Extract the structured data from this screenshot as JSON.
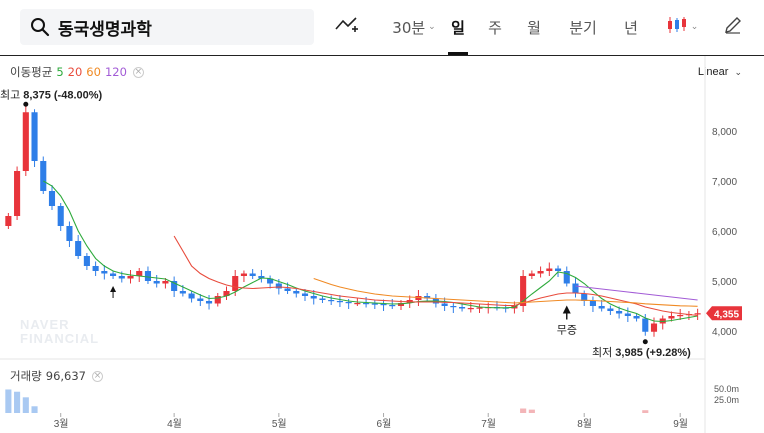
{
  "search": {
    "stock_name": "동국생명과학"
  },
  "toolbar": {
    "interval_label": "30분",
    "periods": [
      "일",
      "주",
      "월",
      "분기",
      "년"
    ],
    "active_period": "일"
  },
  "legend": {
    "ma_title": "이동평균",
    "ma_periods": [
      "5",
      "20",
      "60",
      "120"
    ],
    "scale": "Linear"
  },
  "annotations": {
    "high_label": "최고",
    "high_value": "8,375 (-48.00%)",
    "low_label": "최저",
    "low_value": "3,985 (+9.28%)",
    "event_label": "무증"
  },
  "watermark": [
    "NAVER",
    "FINANCIAL"
  ],
  "volume_legend": {
    "title": "거래량",
    "value": "96,637"
  },
  "colors": {
    "up": "#e8343b",
    "down": "#2e7ee8",
    "ma5": "#2eaa3c",
    "ma20": "#e84b3c",
    "ma60": "#f08a24",
    "ma120": "#a25bd6",
    "current_price_badge": "#e8343b"
  },
  "chart_data": {
    "type": "line",
    "subtype": "candlestick",
    "x_label_months": [
      "3월",
      "4월",
      "5월",
      "6월",
      "7월",
      "8월",
      "9월"
    ],
    "y_ticks": [
      "8,000",
      "7,000",
      "6,000",
      "5,000",
      "4,000"
    ],
    "y_tick_values": [
      8000,
      7000,
      6000,
      5000,
      4000
    ],
    "ylim": [
      3500,
      8700
    ],
    "current_price_label": "4,355",
    "current_price": 4355,
    "volume_ticks": [
      "50.0m",
      "25.0m"
    ],
    "series": [
      {
        "name": "price",
        "values": [
          6300,
          7200,
          8375,
          7400,
          6800,
          6500,
          6100,
          5800,
          5500,
          5300,
          5200,
          5150,
          5100,
          5050,
          5100,
          5200,
          5000,
          4950,
          5000,
          4800,
          4750,
          4650,
          4600,
          4550,
          4700,
          4800,
          5100,
          5150,
          5100,
          5050,
          4950,
          4850,
          4800,
          4750,
          4700,
          4650,
          4620,
          4600,
          4580,
          4560,
          4560,
          4550,
          4540,
          4520,
          4500,
          4560,
          4620,
          4700,
          4650,
          4550,
          4500,
          4480,
          4450,
          4460,
          4470,
          4480,
          4470,
          4450,
          4500,
          5100,
          5150,
          5200,
          5250,
          5200,
          4950,
          4750,
          4600,
          4500,
          4450,
          4400,
          4350,
          4300,
          4250,
          3985,
          4150,
          4250,
          4300,
          4320,
          4340,
          4355
        ]
      },
      {
        "name": "MA5",
        "values": [
          null,
          null,
          null,
          null,
          7000,
          6900,
          6700,
          6400,
          6000,
          5700,
          5450,
          5300,
          5200,
          5150,
          5120,
          5100,
          5080,
          5060,
          5040,
          4960,
          4880,
          4800,
          4720,
          4650,
          4660,
          4700,
          4780,
          4880,
          4970,
          5060,
          5050,
          4990,
          4930,
          4860,
          4800,
          4750,
          4700,
          4660,
          4630,
          4600,
          4580,
          4570,
          4560,
          4550,
          4540,
          4545,
          4560,
          4590,
          4600,
          4600,
          4590,
          4570,
          4540,
          4510,
          4480,
          4470,
          4465,
          4465,
          4475,
          4600,
          4740,
          4870,
          5000,
          5180,
          5150,
          5070,
          4950,
          4800,
          4650,
          4540,
          4460,
          4400,
          4350,
          4260,
          4200,
          4190,
          4210,
          4240,
          4270,
          4300
        ]
      },
      {
        "name": "MA20",
        "values": [
          null,
          null,
          null,
          null,
          null,
          null,
          null,
          null,
          null,
          null,
          null,
          null,
          null,
          null,
          null,
          null,
          null,
          null,
          null,
          5900,
          5600,
          5300,
          5150,
          5050,
          4980,
          4920,
          4880,
          4860,
          4850,
          4860,
          4870,
          4880,
          4870,
          4850,
          4820,
          4790,
          4760,
          4730,
          4700,
          4680,
          4660,
          4640,
          4620,
          4610,
          4600,
          4590,
          4585,
          4580,
          4580,
          4580,
          4575,
          4570,
          4560,
          4550,
          4540,
          4530,
          4520,
          4510,
          4510,
          4560,
          4610,
          4660,
          4700,
          4740,
          4760,
          4760,
          4750,
          4730,
          4700,
          4660,
          4620,
          4580,
          4540,
          4480,
          4440,
          4400,
          4370,
          4350,
          4330,
          4310
        ]
      },
      {
        "name": "MA60",
        "values": [
          null,
          null,
          null,
          null,
          null,
          null,
          null,
          null,
          null,
          null,
          null,
          null,
          null,
          null,
          null,
          null,
          null,
          null,
          null,
          null,
          null,
          null,
          null,
          null,
          null,
          null,
          null,
          null,
          null,
          null,
          null,
          null,
          null,
          null,
          null,
          5050,
          4990,
          4930,
          4880,
          4840,
          4800,
          4770,
          4740,
          4720,
          4700,
          4690,
          4680,
          4670,
          4660,
          4650,
          4640,
          4630,
          4620,
          4610,
          4600,
          4590,
          4580,
          4570,
          4560,
          4570,
          4580,
          4590,
          4600,
          4610,
          4620,
          4620,
          4615,
          4610,
          4600,
          4590,
          4580,
          4570,
          4560,
          4545,
          4535,
          4525,
          4515,
          4505,
          4500,
          4495
        ]
      },
      {
        "name": "MA120",
        "values": [
          null,
          null,
          null,
          null,
          null,
          null,
          null,
          null,
          null,
          null,
          null,
          null,
          null,
          null,
          null,
          null,
          null,
          null,
          null,
          null,
          null,
          null,
          null,
          null,
          null,
          null,
          null,
          null,
          null,
          null,
          null,
          null,
          null,
          null,
          null,
          null,
          null,
          null,
          null,
          null,
          null,
          null,
          null,
          null,
          null,
          null,
          null,
          null,
          null,
          null,
          null,
          null,
          null,
          null,
          null,
          null,
          null,
          null,
          null,
          null,
          null,
          null,
          null,
          null,
          null,
          4900,
          4880,
          4860,
          4840,
          4820,
          4800,
          4780,
          4760,
          4740,
          4720,
          4700,
          4680,
          4660,
          4640,
          4620
        ]
      }
    ],
    "volume_spikes": [
      {
        "index": 0,
        "value": 42
      },
      {
        "index": 1,
        "value": 38
      },
      {
        "index": 2,
        "value": 28
      },
      {
        "index": 3,
        "value": 12
      },
      {
        "index": 59,
        "value": 8
      },
      {
        "index": 60,
        "value": 6
      },
      {
        "index": 73,
        "value": 5
      }
    ],
    "grid": false,
    "legend_position": "top-left"
  }
}
